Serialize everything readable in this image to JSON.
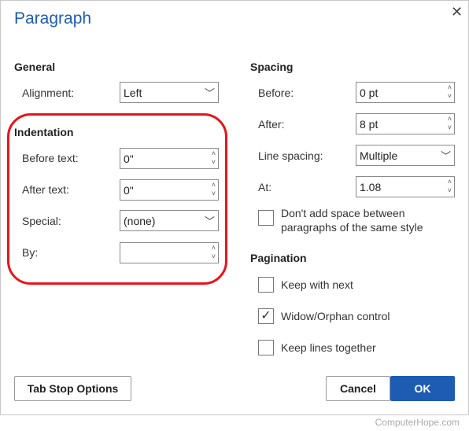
{
  "dialog": {
    "title": "Paragraph",
    "close_icon": "close-icon"
  },
  "general": {
    "header": "General",
    "alignment_label": "Alignment:",
    "alignment_value": "Left"
  },
  "indentation": {
    "header": "Indentation",
    "before_label": "Before text:",
    "before_value": "0\"",
    "after_label": "After text:",
    "after_value": "0\"",
    "special_label": "Special:",
    "special_value": "(none)",
    "by_label": "By:",
    "by_value": ""
  },
  "spacing": {
    "header": "Spacing",
    "before_label": "Before:",
    "before_value": "0 pt",
    "after_label": "After:",
    "after_value": "8 pt",
    "line_label": "Line spacing:",
    "line_value": "Multiple",
    "at_label": "At:",
    "at_value": "1.08",
    "dont_add_line1": "Don't add space between",
    "dont_add_line2": "paragraphs of the same style",
    "dont_add_checked": false
  },
  "pagination": {
    "header": "Pagination",
    "items": [
      {
        "label": "Keep with next",
        "checked": false
      },
      {
        "label": "Widow/Orphan control",
        "checked": true
      },
      {
        "label": "Keep lines together",
        "checked": false
      }
    ]
  },
  "buttons": {
    "tab_stops": "Tab Stop Options",
    "cancel": "Cancel",
    "ok": "OK"
  },
  "colors": {
    "accent": "#1e5cb3",
    "highlight": "#e8141b"
  },
  "watermark": "ComputerHope.com"
}
